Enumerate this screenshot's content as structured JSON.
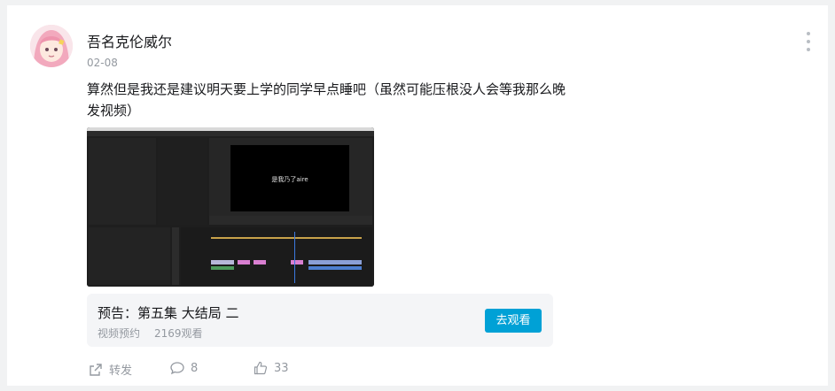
{
  "author": {
    "name": "吾名克伦威尔",
    "date": "02-08"
  },
  "post": {
    "text": "算然但是我还是建议明天要上学的同学早点睡吧（虽然可能压根没人会等我那么晚发视频）"
  },
  "screenshot": {
    "caption": "是我乃了aire"
  },
  "video": {
    "title": "预告：第五集 大结局 二",
    "type": "视频预约",
    "views": "2169观看",
    "watch_label": "去观看"
  },
  "actions": {
    "share_label": "转发",
    "comment_count": "8",
    "like_count": "33"
  },
  "colors": {
    "accent": "#00a1d6",
    "muted": "#9499a0"
  }
}
